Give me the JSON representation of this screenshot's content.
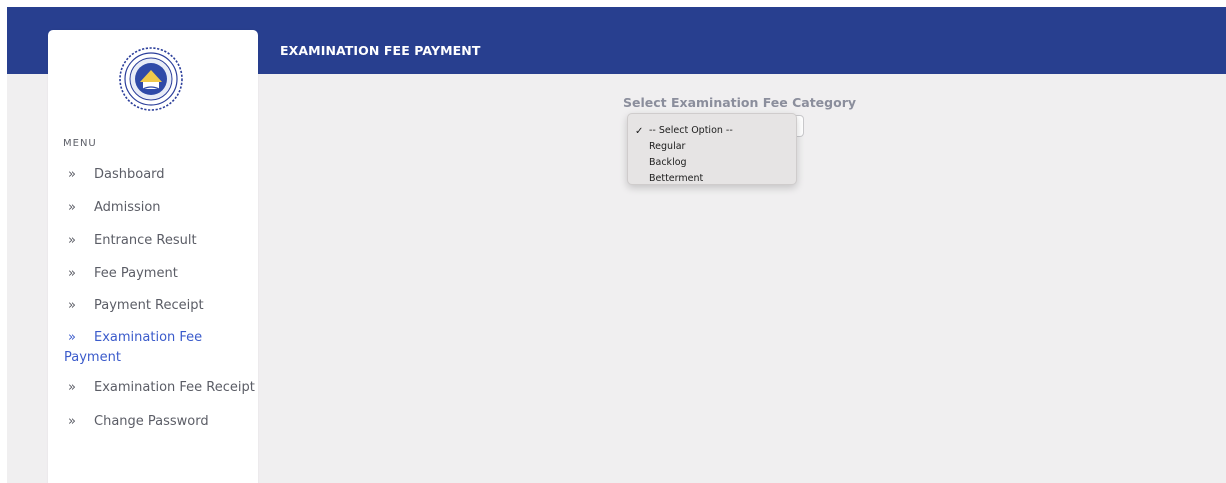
{
  "header": {
    "title": "EXAMINATION FEE PAYMENT",
    "background_color": "#283f8f"
  },
  "sidebar": {
    "logo_icon": "institution-seal-logo",
    "menu_heading": "MENU",
    "chevron_glyph": "»",
    "items": [
      {
        "label": "Dashboard",
        "active": false
      },
      {
        "label": "Admission",
        "active": false
      },
      {
        "label": "Entrance Result",
        "active": false
      },
      {
        "label": "Fee Payment",
        "active": false
      },
      {
        "label": "Payment Receipt",
        "active": false
      },
      {
        "label": "Examination Fee",
        "label_cont": "Payment",
        "active": true
      },
      {
        "label": "Examination Fee Receipt",
        "active": false
      },
      {
        "label": "Change Password",
        "active": false
      }
    ],
    "active_color": "#3b5bcb"
  },
  "main": {
    "select_label": "Select Examination Fee Category",
    "select": {
      "selected": "-- Select Option --",
      "options": [
        "-- Select Option --",
        "Regular",
        "Backlog",
        "Betterment"
      ]
    }
  }
}
